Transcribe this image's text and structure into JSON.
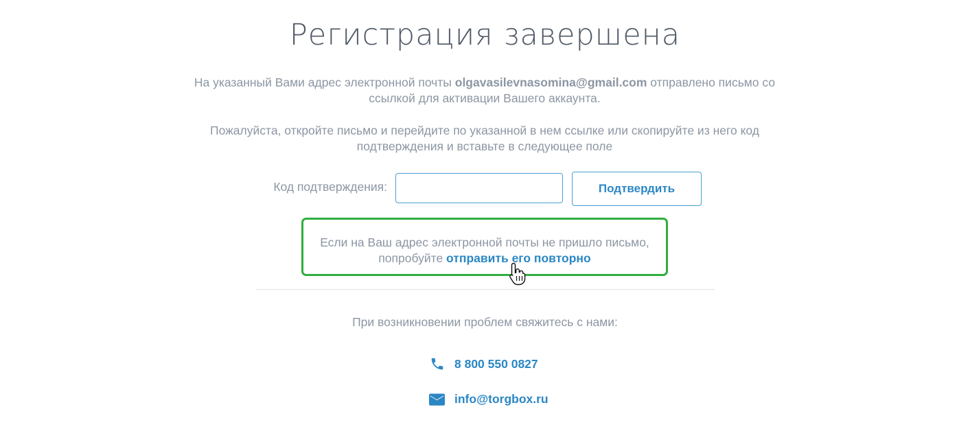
{
  "page": {
    "title": "Регистрация завершена"
  },
  "info": {
    "para1_prefix": "На указанный Вами адрес электронной почты ",
    "email": "olgavasilevnasomina@gmail.com",
    "para1_suffix": " отправлено письмо со ссылкой для активации Вашего аккаунта.",
    "para2": "Пожалуйста, откройте письмо и перейдите по указанной в нем ссылке или скопируйте из него код подтверждения и вставьте в следующее поле"
  },
  "form": {
    "code_label": "Код подтверждения:",
    "code_value": "",
    "confirm_label": "Подтвердить"
  },
  "resend": {
    "line1": "Если на Ваш адрес электронной почты не пришло письмо,",
    "line2_prefix": "попробуйте ",
    "link_label": "отправить его повторно"
  },
  "contacts": {
    "heading": "При возникновении проблем свяжитесь с нами:",
    "phone": "8 800 550 0827",
    "email": "info@torgbox.ru",
    "phone_icon": "phone-icon",
    "email_icon": "envelope-icon"
  },
  "colors": {
    "accent": "#2b87c4",
    "highlight_border": "#2fae3d",
    "text_muted": "#8c96a3",
    "title": "#4f5966"
  }
}
